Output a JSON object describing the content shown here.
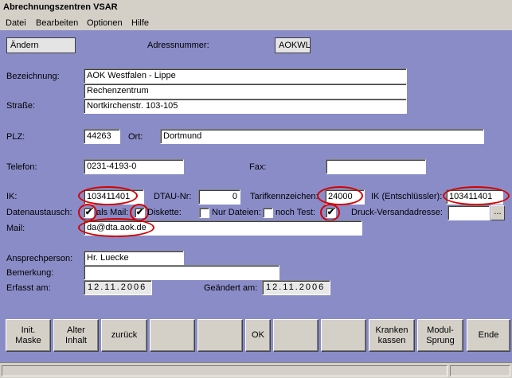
{
  "window": {
    "title": "Abrechnungszentren VSAR"
  },
  "menu": [
    "Datei",
    "Bearbeiten",
    "Optionen",
    "Hilfe"
  ],
  "mode": {
    "value": "Ändern"
  },
  "adressnummer": {
    "label": "Adressnummer:",
    "value": "AOKWL"
  },
  "bezeichnung": {
    "label": "Bezeichnung:",
    "line1": "AOK Westfalen - Lippe",
    "line2": "Rechenzentrum"
  },
  "strasse": {
    "label": "Straße:",
    "value": "Nortkirchenstr. 103-105"
  },
  "plz": {
    "label": "PLZ:",
    "value": "44263"
  },
  "ort": {
    "label": "Ort:",
    "value": "Dortmund"
  },
  "telefon": {
    "label": "Telefon:",
    "value": "0231-4193-0"
  },
  "fax": {
    "label": "Fax:",
    "value": ""
  },
  "ik": {
    "label": "IK:",
    "value": "103411401"
  },
  "dtau": {
    "label": "DTAU-Nr:",
    "value": "0"
  },
  "tarif": {
    "label": "Tarifkennzeichen:",
    "value": "24000"
  },
  "ik_ent": {
    "label": "IK (Entschlüssler):",
    "value": "103411401"
  },
  "datenaustausch": {
    "label": "Datenaustausch:",
    "als_mail": {
      "label": "als Mail:",
      "checked": true
    },
    "diskette": {
      "label": "Diskette:",
      "checked": true
    },
    "nur_dateien": {
      "label": "Nur Dateien:",
      "checked": false
    },
    "noch_test": {
      "label": "noch Test:",
      "checked": true
    },
    "druck_label": "Druck-Versandadresse:",
    "druck_value": "",
    "browse_label": "..."
  },
  "mail": {
    "label": "Mail:",
    "value": "da@dta.aok.de"
  },
  "ansprechperson": {
    "label": "Ansprechperson:",
    "value": "Hr. Luecke"
  },
  "bemerkung": {
    "label": "Bemerkung:",
    "value": ""
  },
  "erfasst": {
    "label": "Erfasst am:",
    "value": "12.11.2006"
  },
  "geaendert": {
    "label": "Geändert am:",
    "value": "12.11.2006"
  },
  "buttons": {
    "init": "Init.\nMaske",
    "alter": "Alter\nInhalt",
    "zurueck": "zurück",
    "blank1": "",
    "blank2": "",
    "ok": "OK",
    "blank3": "",
    "blank4": "",
    "kranken": "Kranken\nkassen",
    "modul": "Modul-\nSprung",
    "ende": "Ende"
  },
  "colors": {
    "form_bg": "#8a8cc8",
    "highlight_ring": "#d40000"
  }
}
